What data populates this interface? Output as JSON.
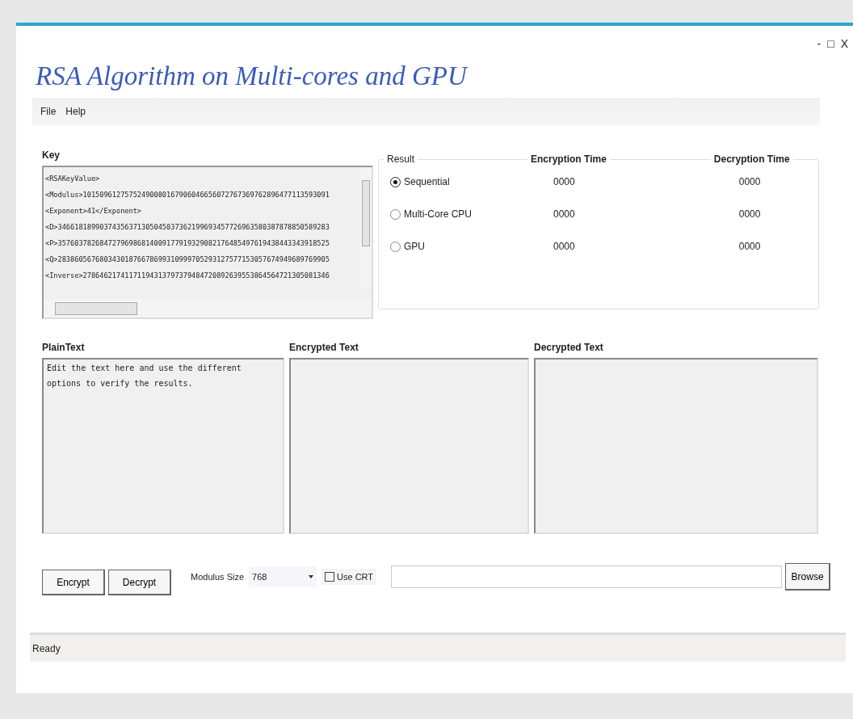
{
  "window": {
    "title": "RSA Algorithm on Multi-cores and GPU",
    "controls": [
      "-",
      "□",
      "X"
    ]
  },
  "menu": [
    "File",
    "Help"
  ],
  "key": {
    "label": "Key",
    "lines": [
      "<RSAKeyValue>",
      "<Modulus>1015096127575249008016790604665607276736976289647711359309​1",
      "<Exponent>41</Exponent>",
      "<D>34661818990374356371305045037362199693457726963580387878850589283",
      "<P>35760378268472796986814009177919329082176485497619438443343918525",
      "<Q>28386056768034301876678699310999705293127577153057674949689769905",
      "<Inverse>2786462174117119431379737948472089263955386456472130508134​6"
    ]
  },
  "result": {
    "label": "Result",
    "columns": [
      "Encryption Time",
      "Decryption Time"
    ],
    "rows": [
      {
        "label": "Sequential",
        "selected": true,
        "encryption": "0000",
        "decryption": "0000"
      },
      {
        "label": "Multi-Core CPU",
        "selected": false,
        "encryption": "0000",
        "decryption": "0000"
      },
      {
        "label": "GPU",
        "selected": false,
        "encryption": "0000",
        "decryption": "0000"
      }
    ]
  },
  "panes": [
    {
      "label": "PlainText",
      "value": "Edit the text here and use the different options to verify the results."
    },
    {
      "label": "Encrypted Text"
    },
    {
      "label": "Decrypted Text"
    }
  ],
  "buttons": [
    "Encrypt",
    "Decrypt"
  ],
  "modulus": {
    "label": "Modulus Size",
    "value": "768"
  },
  "use_crt": {
    "label": "Use CRT",
    "checked": false
  },
  "browse": {
    "button": "Browse"
  },
  "status_bar": "Ready"
}
